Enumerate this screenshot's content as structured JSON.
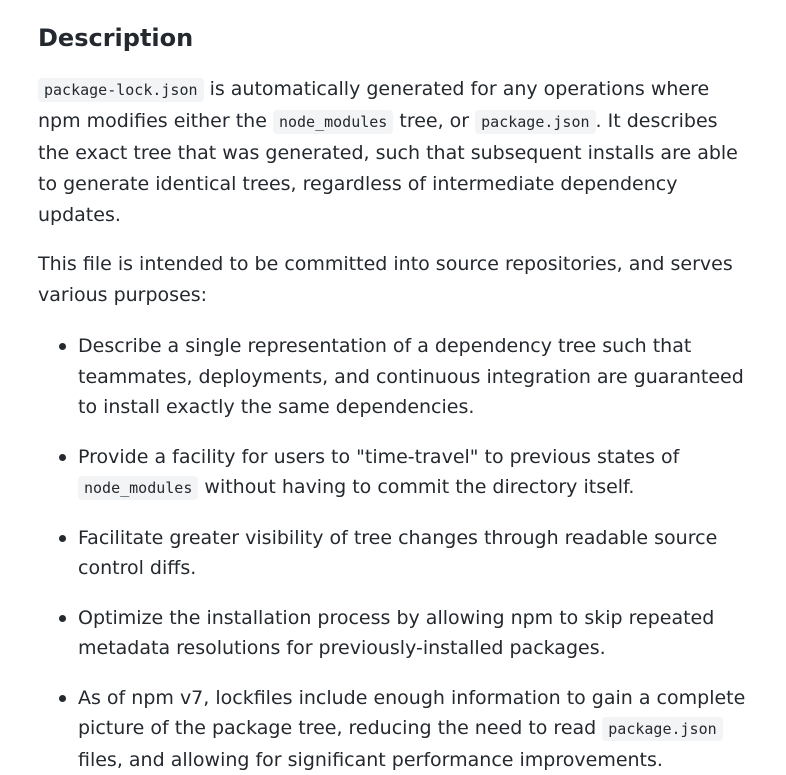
{
  "section": {
    "title": "Description"
  },
  "para1": {
    "code1": "package-lock.json",
    "text1": " is automatically generated for any operations where npm modifies either the ",
    "code2": "node_modules",
    "text2": " tree, or ",
    "code3": "package.json",
    "text3": ". It describes the exact tree that was generated, such that subsequent installs are able to generate identical trees, regardless of intermediate dependency updates."
  },
  "para2": {
    "text": "This file is intended to be committed into source repositories, and serves various purposes:"
  },
  "purposes": [
    {
      "text1": "Describe a single representation of a dependency tree such that teammates, deployments, and continuous integration are guaranteed to install exactly the same dependencies."
    },
    {
      "text1": "Provide a facility for users to \"time-travel\" to previous states of ",
      "code": "node_modules",
      "text2": " without having to commit the directory itself."
    },
    {
      "text1": "Facilitate greater visibility of tree changes through readable source control diffs."
    },
    {
      "text1": "Optimize the installation process by allowing npm to skip repeated metadata resolutions for previously-installed packages."
    },
    {
      "text1": "As of npm v7, lockfiles include enough information to gain a complete picture of the package tree, reducing the need to read ",
      "code": "package.json",
      "text2": " files, and allowing for significant performance improvements."
    }
  ]
}
